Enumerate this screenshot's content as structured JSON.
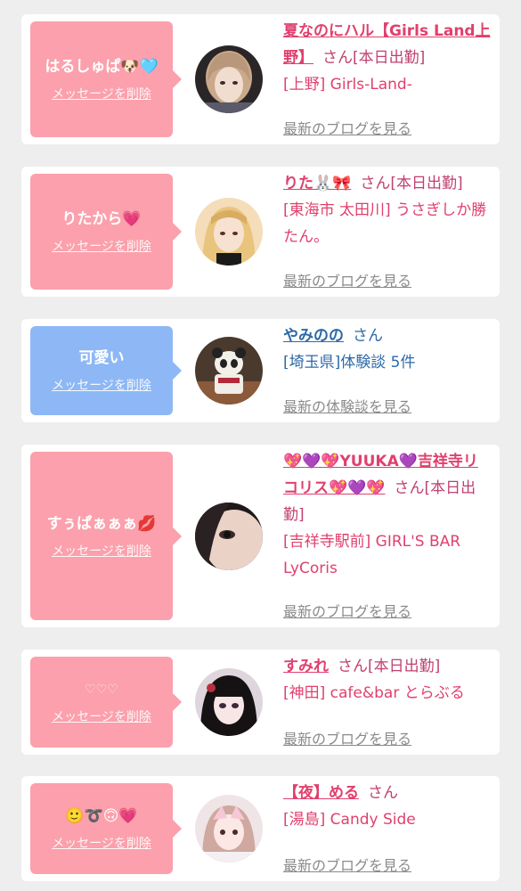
{
  "delete_label": "メッセージを削除",
  "san_label": "さん",
  "colors": {
    "pink_bubble": "#fba0ac",
    "blue_bubble": "#8db8f5",
    "name_pink": "#e0406e",
    "name_blue": "#2d6aa8",
    "link_gray": "#8a8a8a"
  },
  "items": [
    {
      "message": "はるしゅぱ🐶🩵",
      "name": "夏なのにハル【Girls Land上野】",
      "suffix": "さん[本日出勤]",
      "detail": "[上野] Girls-Land-",
      "link": "最新のブログを見る",
      "bubble": "pink"
    },
    {
      "message": "りたから💗",
      "name": "りた🐰🎀",
      "suffix": "さん[本日出勤]",
      "detail": "[東海市 太田川] うさぎしか勝たん。",
      "link": "最新のブログを見る",
      "bubble": "pink"
    },
    {
      "message": "可愛い",
      "name": "やみのの",
      "suffix": "さん",
      "detail": "[埼玉県]体験談 5件",
      "link": "最新の体験談を見る",
      "bubble": "blue"
    },
    {
      "message": "すぅぱぁぁぁ💋",
      "name": "💖💜💖YUUKA💜吉祥寺リコリス💖💜💖",
      "suffix": "さん[本日出勤]",
      "detail": "[吉祥寺駅前] GIRL'S BAR LyCoris",
      "link": "最新のブログを見る",
      "bubble": "pink"
    },
    {
      "message": "♡♡♡",
      "name": "すみれ",
      "suffix": "さん[本日出勤]",
      "detail": "[神田] cafe&bar とらぶる",
      "link": "最新のブログを見る",
      "bubble": "pink"
    },
    {
      "message": "🙂➰🙃💗",
      "name": "【夜】める",
      "suffix": "さん",
      "detail": "[湯島] Candy Side",
      "link": "最新のブログを見る",
      "bubble": "pink"
    }
  ]
}
